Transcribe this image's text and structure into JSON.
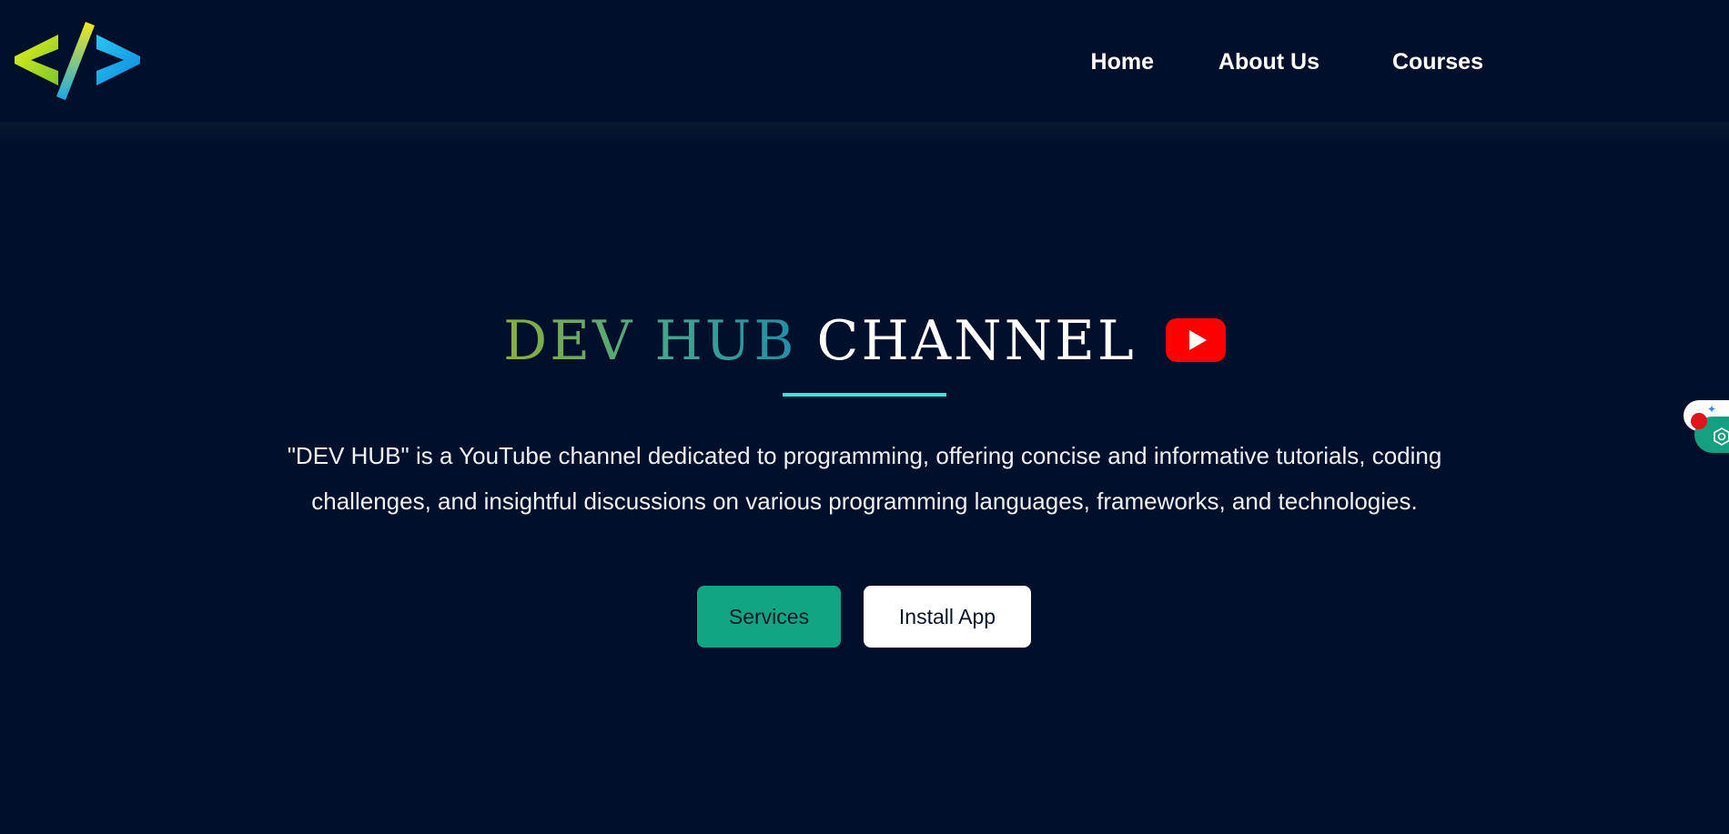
{
  "header": {
    "logo_icon": "code-brackets-logo-icon",
    "nav": [
      {
        "label": "Home"
      },
      {
        "label": "About Us"
      },
      {
        "label": "Courses"
      }
    ]
  },
  "hero": {
    "title_accent": "DEV HUB",
    "title_main": "CHANNEL",
    "title_icon": "youtube-play-icon",
    "description": "\"DEV HUB\" is a YouTube channel dedicated to programming, offering concise and informative tutorials, coding challenges, and insightful discussions on various programming languages, frameworks, and technologies.",
    "buttons": {
      "services_label": "Services",
      "install_label": "Install App"
    }
  },
  "side_widget": {
    "icons": [
      "record-dot-icon",
      "sparkle-icon",
      "gear-icon"
    ]
  },
  "colors": {
    "background": "#00102a",
    "accent_teal": "#39e6d5",
    "services_button": "#12a583",
    "youtube_red": "#ff0000"
  }
}
